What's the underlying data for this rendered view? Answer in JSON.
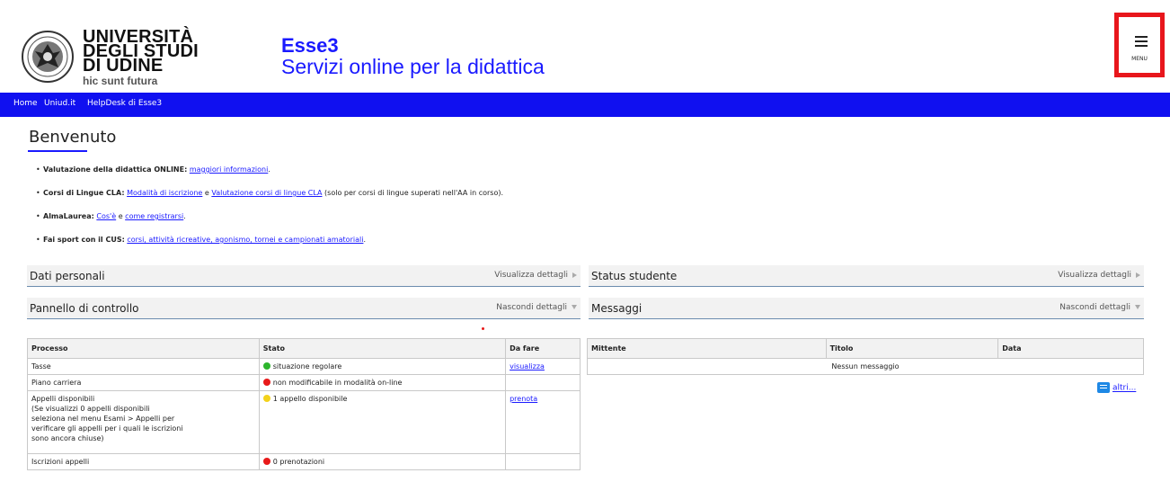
{
  "header": {
    "logo_lines": [
      "UNIVERSITÀ",
      "DEGLI STUDI",
      "DI UDINE"
    ],
    "logo_motto": "hic sunt futura",
    "app_title": "Esse3",
    "app_subtitle": "Servizi online per la didattica",
    "menu_label": "MENU"
  },
  "nav": {
    "items": [
      "Home",
      "Uniud.it",
      "HelpDesk di Esse3"
    ]
  },
  "welcome": {
    "title": "Benvenuto"
  },
  "info": {
    "line1_label": "Valutazione della didattica ONLINE:",
    "line1_link": "maggiori informazioni",
    "line2_label": "Corsi di Lingue CLA:",
    "line2_link1": "Modalità di iscrizione",
    "line2_mid": "e",
    "line2_link2": "Valutazione corsi di lingue CLA",
    "line2_tail": "(solo per corsi di lingue superati nell'AA in corso).",
    "line3_label": "AlmaLaurea:",
    "line3_link1": "Cos'è",
    "line3_mid": "e",
    "line3_link2": "come registrarsi",
    "line4_label": "Fai sport con il CUS:",
    "line4_link": "corsi, attività ricreative, agonismo, tornei e campionati amatoriali"
  },
  "panels": {
    "dati_personali": {
      "title": "Dati personali",
      "action": "Visualizza dettagli"
    },
    "status_studente": {
      "title": "Status studente",
      "action": "Visualizza dettagli"
    },
    "pannello": {
      "title": "Pannello di controllo",
      "action": "Nascondi dettagli"
    },
    "messaggi": {
      "title": "Messaggi",
      "action": "Nascondi dettagli"
    }
  },
  "control_table": {
    "headers": [
      "Processo",
      "Stato",
      "Da fare"
    ],
    "rows": [
      {
        "processo": "Tasse",
        "stato": "situazione regolare",
        "color": "#2db52d",
        "azione": "visualizza"
      },
      {
        "processo": "Piano carriera",
        "stato": "non modificabile in modalità on-line",
        "color": "#e81a1a",
        "azione": ""
      },
      {
        "processo": "Appelli disponibili",
        "note": "(Se visualizzi 0 appelli disponibili seleziona nel menu Esami > Appelli per verificare gli appelli per i quali le iscrizioni sono ancora chiuse)",
        "stato": "1 appello disponibile",
        "color": "#f3d21b",
        "azione": "prenota"
      },
      {
        "processo": "Iscrizioni appelli",
        "stato": "0 prenotazioni",
        "color": "#e81a1a",
        "azione": ""
      }
    ]
  },
  "messages_table": {
    "headers": [
      "Mittente",
      "Titolo",
      "Data"
    ],
    "empty": "Nessun messaggio",
    "more": "altri..."
  }
}
